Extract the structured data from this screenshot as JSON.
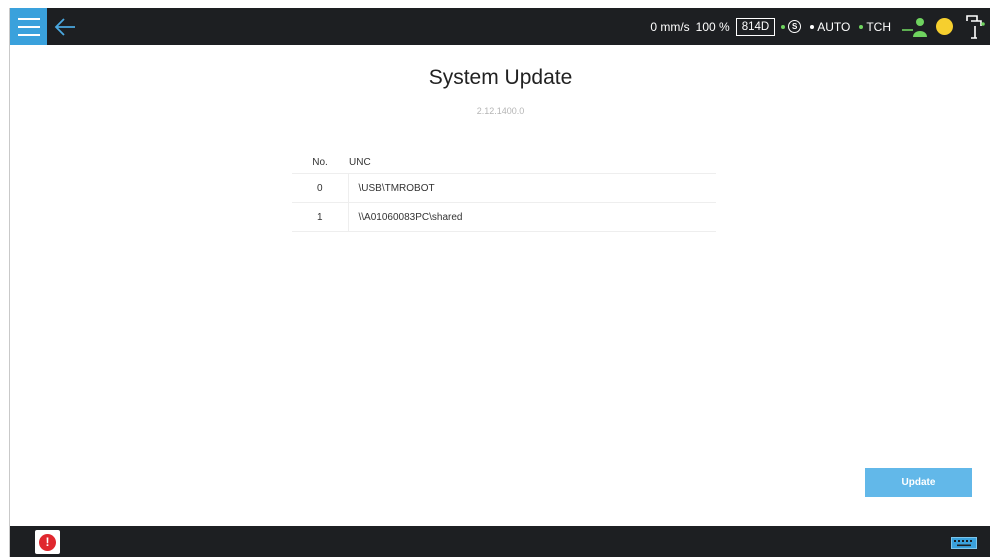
{
  "topbar": {
    "speed": "0 mm/s",
    "percent": "100 %",
    "mode_code": "814D",
    "s_label": "S",
    "auto_label": "AUTO",
    "tch_label": "TCH",
    "menu_icon": "hamburger-icon",
    "back_icon": "back-arrow-icon",
    "user_icon": "user-status-icon",
    "light_icon": "status-light-icon",
    "robot_icon": "robot-arm-icon"
  },
  "page": {
    "title": "System Update",
    "version": "2.12.1400.0"
  },
  "table": {
    "headers": {
      "no": "No.",
      "unc": "UNC"
    },
    "rows": [
      {
        "no": "0",
        "path": "\\USB\\TMROBOT"
      },
      {
        "no": "1",
        "path": "\\\\A01060083PC\\shared"
      }
    ]
  },
  "actions": {
    "update_label": "Update"
  },
  "bottombar": {
    "error_icon": "error-icon",
    "keyboard_icon": "keyboard-icon"
  },
  "colors": {
    "accent": "#3aa1dc",
    "bar": "#1d1f22",
    "button": "#62b8e9",
    "light": "#f6cf2e",
    "indicator": "#6fd35f"
  }
}
